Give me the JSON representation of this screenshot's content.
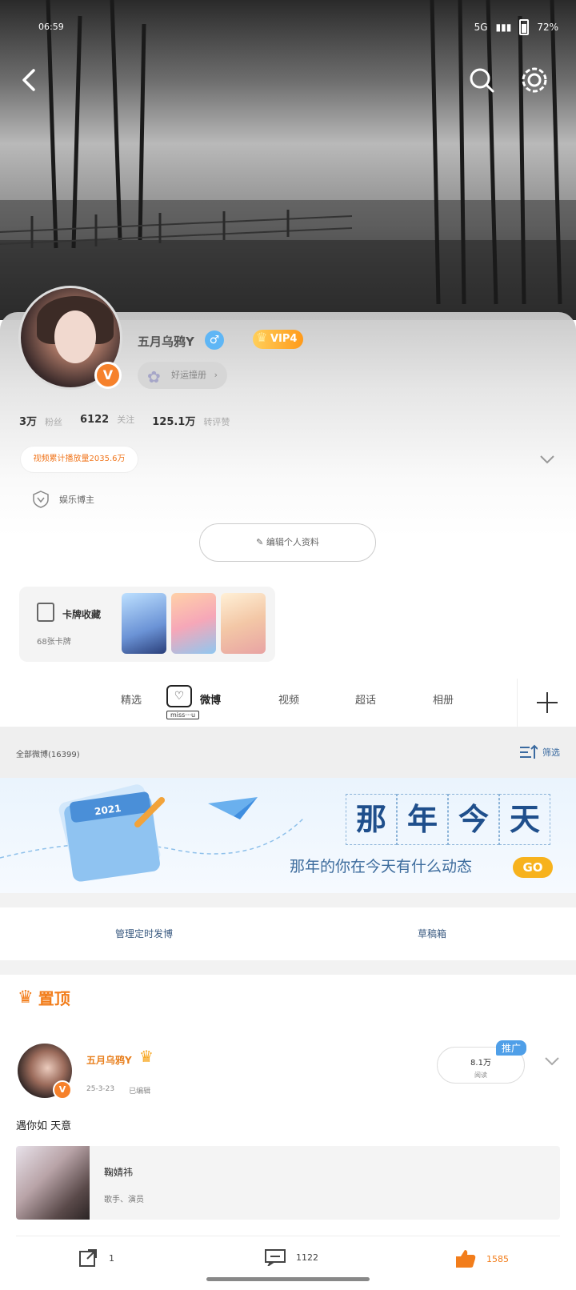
{
  "status_bar": {
    "time": "06:59",
    "battery": "72%",
    "signal": "5G"
  },
  "header": {
    "back_icon": "chevron-left-icon",
    "search_icon": "search-icon",
    "settings_icon": "gear-icon"
  },
  "profile": {
    "username": "五月乌鸦Y",
    "gender_symbol": "♂",
    "vip_label": "VIP4",
    "v_badge": "V",
    "lucky_button": "好运撞册",
    "stats": [
      {
        "value": "3万",
        "label": "粉丝"
      },
      {
        "value": "6122",
        "label": "关注"
      },
      {
        "value": "125.1万",
        "label": "转评赞"
      }
    ],
    "play_count": "视频累计播放量2035.6万",
    "blogger_tag": "娱乐博主",
    "edit_button": "编辑个人资料"
  },
  "cards": {
    "title": "卡牌收藏",
    "count": "68张卡牌"
  },
  "tabs": [
    {
      "label": "精选"
    },
    {
      "label": "微博",
      "active": true,
      "sticker": "miss···u"
    },
    {
      "label": "视频"
    },
    {
      "label": "超话"
    },
    {
      "label": "相册"
    }
  ],
  "feed_header": {
    "all_label": "全部微博(16399)",
    "filter_label": "筛选"
  },
  "banner": {
    "title_chars": [
      "那",
      "年",
      "今",
      "天"
    ],
    "subtitle": "那年的你在今天有什么动态",
    "go": "GO",
    "calendar_year": "2021"
  },
  "manage": {
    "scheduled": "管理定时发博",
    "drafts": "草稿箱"
  },
  "pinned": {
    "label": "置顶",
    "author": "五月乌鸦Y",
    "date": "25-3-23",
    "edited": "已编辑",
    "read_count": "8.1万",
    "read_label": "阅读",
    "promo_tag": "推广",
    "text": "遇你如 天意",
    "link_card": {
      "name": "鞠婧祎",
      "desc": "歌手、演员"
    },
    "actions": {
      "repost": "1",
      "comment": "1122",
      "like": "1585"
    }
  },
  "colors": {
    "accent_orange": "#f27d1b",
    "link_blue": "#3a5a80",
    "vip_gold": "#ff9a1a"
  }
}
